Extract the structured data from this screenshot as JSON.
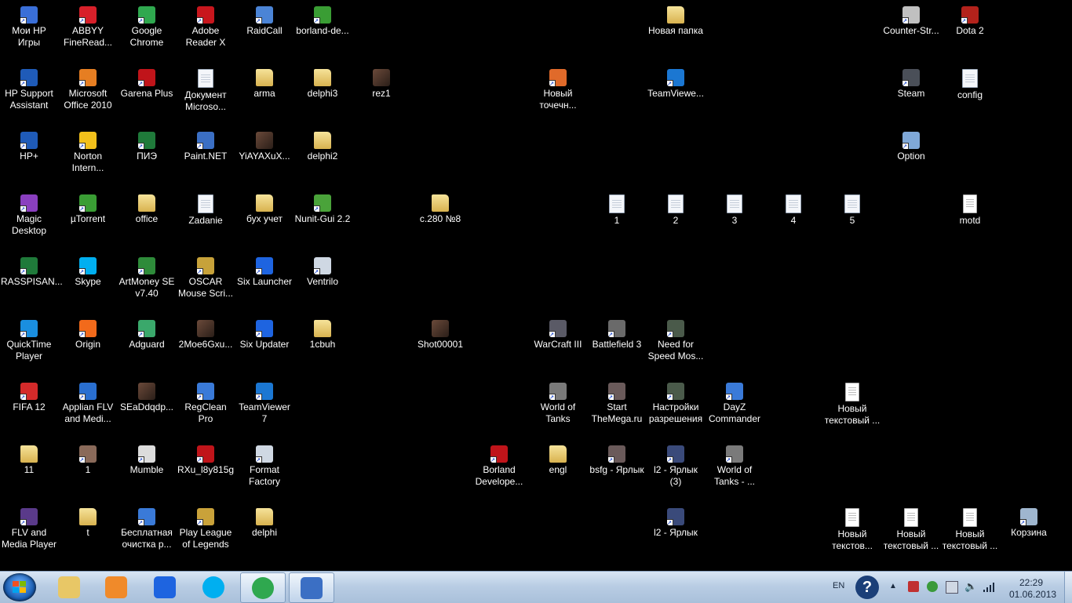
{
  "desktop_icons": [
    {
      "name": "moi-hp-igry",
      "label": "Мои HP Игры",
      "kind": "app",
      "color": "#3a6fd8"
    },
    {
      "name": "abbyy-finereader",
      "label": "ABBYY FineRead...",
      "kind": "app",
      "color": "#d8202a"
    },
    {
      "name": "google-chrome",
      "label": "Google Chrome",
      "kind": "app",
      "color": "#2fa84f"
    },
    {
      "name": "adobe-reader-x",
      "label": "Adobe Reader X",
      "kind": "app",
      "color": "#c8161d"
    },
    {
      "name": "raidcall",
      "label": "RaidCall",
      "kind": "app",
      "color": "#4b84d6"
    },
    {
      "name": "borland-de",
      "label": "borland-de...",
      "kind": "app",
      "color": "#3a9d34"
    },
    {
      "name": "novaya-papka",
      "label": "Новая папка",
      "kind": "folder",
      "color": "#e8c766"
    },
    {
      "name": "counter-strike",
      "label": "Counter-Str...",
      "kind": "app",
      "color": "#c0c0c0"
    },
    {
      "name": "dota-2",
      "label": "Dota 2",
      "kind": "app",
      "color": "#b3221b"
    },
    {
      "name": "hp-support-assistant",
      "label": "HP Support Assistant",
      "kind": "app",
      "color": "#1f5bb8"
    },
    {
      "name": "microsoft-office-2010",
      "label": "Microsoft Office 2010",
      "kind": "app",
      "color": "#e67e22"
    },
    {
      "name": "garena-plus",
      "label": "Garena Plus",
      "kind": "app",
      "color": "#c0141a"
    },
    {
      "name": "dokument-microsoft",
      "label": "Документ Microso...",
      "kind": "doc",
      "color": "#2b5797"
    },
    {
      "name": "arma",
      "label": "arma",
      "kind": "folder",
      "color": "#e8c766"
    },
    {
      "name": "delphi3",
      "label": "delphi3",
      "kind": "folder",
      "color": "#e8c766"
    },
    {
      "name": "rez1",
      "label": "rez1",
      "kind": "thumb",
      "color": "#5a4a3a"
    },
    {
      "name": "novyy-tochechnyy",
      "label": "Новый точечн...",
      "kind": "app",
      "color": "#e06a2a"
    },
    {
      "name": "teamviewer-top",
      "label": "TeamViewe...",
      "kind": "app",
      "color": "#1b77d2"
    },
    {
      "name": "steam",
      "label": "Steam",
      "kind": "app",
      "color": "#4a4f58"
    },
    {
      "name": "config",
      "label": "config",
      "kind": "doc",
      "color": "#7fa8d8"
    },
    {
      "name": "hp-plus",
      "label": "HP+",
      "kind": "app",
      "color": "#1f5bb8"
    },
    {
      "name": "norton-internet",
      "label": "Norton Intern...",
      "kind": "app",
      "color": "#f2c01b"
    },
    {
      "name": "piz",
      "label": "ПИЭ",
      "kind": "app",
      "color": "#1f7a3a"
    },
    {
      "name": "paint-net",
      "label": "Paint.NET",
      "kind": "app",
      "color": "#3b6fc4"
    },
    {
      "name": "yiayaxux",
      "label": "YiAYAXuX...",
      "kind": "thumb",
      "color": "#6b4a3a"
    },
    {
      "name": "delphi2",
      "label": "delphi2",
      "kind": "folder",
      "color": "#e8c766"
    },
    {
      "name": "option",
      "label": "Option",
      "kind": "app",
      "color": "#7fa8d8"
    },
    {
      "name": "magic-desktop",
      "label": "Magic Desktop",
      "kind": "app",
      "color": "#8a3fbf"
    },
    {
      "name": "utorrent",
      "label": "µTorrent",
      "kind": "app",
      "color": "#3a9d34"
    },
    {
      "name": "office",
      "label": "office",
      "kind": "folder",
      "color": "#e8c766"
    },
    {
      "name": "zadanie",
      "label": "Zadanie",
      "kind": "doc",
      "color": "#2b5797"
    },
    {
      "name": "buh-uchet",
      "label": "бух учет",
      "kind": "folder",
      "color": "#e8c766"
    },
    {
      "name": "nunit-gui",
      "label": "Nunit-Gui 2.2",
      "kind": "app",
      "color": "#4aa33a"
    },
    {
      "name": "c280-n8",
      "label": "с.280 №8",
      "kind": "folder",
      "color": "#e8c766"
    },
    {
      "name": "doc-1",
      "label": "1",
      "kind": "doc",
      "color": "#2b5797"
    },
    {
      "name": "doc-2",
      "label": "2",
      "kind": "doc",
      "color": "#2b5797"
    },
    {
      "name": "doc-3",
      "label": "3",
      "kind": "doc",
      "color": "#2b5797"
    },
    {
      "name": "doc-4",
      "label": "4",
      "kind": "doc",
      "color": "#2b5797"
    },
    {
      "name": "doc-5",
      "label": "5",
      "kind": "doc",
      "color": "#2b5797"
    },
    {
      "name": "motd",
      "label": "motd",
      "kind": "text",
      "color": "#ffffff"
    },
    {
      "name": "rasspisan",
      "label": "RASSPISAN...",
      "kind": "app",
      "color": "#1f7a3a"
    },
    {
      "name": "skype",
      "label": "Skype",
      "kind": "app",
      "color": "#00aff0"
    },
    {
      "name": "artmoney-se",
      "label": "ArtMoney SE v7.40",
      "kind": "app",
      "color": "#2e8b3a"
    },
    {
      "name": "oscar-mouse",
      "label": "OSCAR Mouse Scri...",
      "kind": "app",
      "color": "#c7a23a"
    },
    {
      "name": "six-launcher",
      "label": "Six Launcher",
      "kind": "app",
      "color": "#1e64e0"
    },
    {
      "name": "ventrilo",
      "label": "Ventrilo",
      "kind": "app",
      "color": "#cfd8e3"
    },
    {
      "name": "quicktime-player",
      "label": "QuickTime Player",
      "kind": "app",
      "color": "#1a8fe0"
    },
    {
      "name": "origin",
      "label": "Origin",
      "kind": "app",
      "color": "#f26a1b"
    },
    {
      "name": "adguard",
      "label": "Adguard",
      "kind": "app",
      "color": "#3aa86b"
    },
    {
      "name": "2moe6gxu",
      "label": "2Moe6Gxu...",
      "kind": "thumb",
      "color": "#5a3a3a"
    },
    {
      "name": "six-updater",
      "label": "Six Updater",
      "kind": "app",
      "color": "#1e64e0"
    },
    {
      "name": "1cbuh",
      "label": "1cbuh",
      "kind": "folder",
      "color": "#e8c766"
    },
    {
      "name": "shot00001",
      "label": "Shot00001",
      "kind": "thumb",
      "color": "#3a2e28"
    },
    {
      "name": "warcraft-iii",
      "label": "WarCraft III",
      "kind": "app",
      "color": "#5a5a66"
    },
    {
      "name": "battlefield-3",
      "label": "Battlefield 3",
      "kind": "app",
      "color": "#6a6a6a"
    },
    {
      "name": "need-for-speed",
      "label": "Need for Speed Mos...",
      "kind": "app",
      "color": "#4a5a4a"
    },
    {
      "name": "fifa-12",
      "label": "FIFA 12",
      "kind": "app",
      "color": "#d42a2a"
    },
    {
      "name": "applian-flv",
      "label": "Applian FLV and Medi...",
      "kind": "app",
      "color": "#2a6fd0"
    },
    {
      "name": "seaddqdp",
      "label": "SEaDdqdp...",
      "kind": "thumb",
      "color": "#6b4a3a"
    },
    {
      "name": "regclean-pro",
      "label": "RegClean Pro",
      "kind": "app",
      "color": "#3a7ad8"
    },
    {
      "name": "teamviewer-7",
      "label": "TeamViewer 7",
      "kind": "app",
      "color": "#1b77d2"
    },
    {
      "name": "world-of-tanks",
      "label": "World of Tanks",
      "kind": "app",
      "color": "#7a7a7a"
    },
    {
      "name": "start-themega",
      "label": "Start TheMega.ru",
      "kind": "app",
      "color": "#6a5a5a"
    },
    {
      "name": "nastroyki-razresheniya",
      "label": "Настройки разрешения",
      "kind": "app",
      "color": "#4a5a4a"
    },
    {
      "name": "dayz-commander",
      "label": "DayZ Commander",
      "kind": "app",
      "color": "#3a7ad8"
    },
    {
      "name": "novyy-tekstovyy-1",
      "label": "Новый текстовый ...",
      "kind": "text",
      "color": "#ffffff"
    },
    {
      "name": "folder-11",
      "label": "11",
      "kind": "folder",
      "color": "#d8c28a"
    },
    {
      "name": "item-1",
      "label": "1",
      "kind": "app",
      "color": "#8a6a5a"
    },
    {
      "name": "mumble",
      "label": "Mumble",
      "kind": "app",
      "color": "#dcdcdc"
    },
    {
      "name": "rxu-l8y815g",
      "label": "RXu_l8y815g",
      "kind": "app",
      "color": "#c0141a"
    },
    {
      "name": "format-factory",
      "label": "Format Factory",
      "kind": "app",
      "color": "#cfd8e3"
    },
    {
      "name": "borland-developer",
      "label": "Borland Develope...",
      "kind": "app",
      "color": "#c0141a"
    },
    {
      "name": "engl",
      "label": "engl",
      "kind": "folder",
      "color": "#e8c766"
    },
    {
      "name": "bsfg-yarlyk",
      "label": "bsfg - Ярлык",
      "kind": "app",
      "color": "#6a5a5a"
    },
    {
      "name": "l2-yarlyk-3",
      "label": "l2 - Ярлык (3)",
      "kind": "app",
      "color": "#3a4a7a"
    },
    {
      "name": "world-of-tanks-2",
      "label": "World of Tanks - ...",
      "kind": "app",
      "color": "#7a7a7a"
    },
    {
      "name": "flv-media-player",
      "label": "FLV and Media Player",
      "kind": "app",
      "color": "#5a3a8a"
    },
    {
      "name": "t",
      "label": "t",
      "kind": "folder",
      "color": "#e8c766"
    },
    {
      "name": "besplatnaya-ochistka",
      "label": "Бесплатная очистка р...",
      "kind": "app",
      "color": "#3a7ad8"
    },
    {
      "name": "play-league",
      "label": "Play League of Legends",
      "kind": "app",
      "color": "#c9a23a"
    },
    {
      "name": "delphi",
      "label": "delphi",
      "kind": "folder",
      "color": "#e8c766"
    },
    {
      "name": "l2-yarlyk",
      "label": "l2 - Ярлык",
      "kind": "app",
      "color": "#3a4a7a"
    },
    {
      "name": "novyy-tekstov-2",
      "label": "Новый текстов...",
      "kind": "text",
      "color": "#ffffff"
    },
    {
      "name": "novyy-tekstovyy-3",
      "label": "Новый текстовый ...",
      "kind": "text",
      "color": "#ffffff"
    },
    {
      "name": "novyy-tekstovyy-4",
      "label": "Новый текстовый ...",
      "kind": "text",
      "color": "#ffffff"
    },
    {
      "name": "korzina",
      "label": "Корзина",
      "kind": "app",
      "color": "#9fb6cf"
    }
  ],
  "taskbar": {
    "pinned": [
      {
        "name": "explorer",
        "icon": "folder-icon",
        "color": "#e8c766",
        "active": false
      },
      {
        "name": "media-player",
        "icon": "media-player-icon",
        "color": "#f08a2a",
        "active": false
      },
      {
        "name": "six-launcher",
        "icon": "six-launcher-icon",
        "color": "#1e64e0",
        "active": false
      },
      {
        "name": "skype",
        "icon": "skype-icon",
        "color": "#00aff0",
        "active": false
      },
      {
        "name": "chrome",
        "icon": "chrome-icon",
        "color": "#2fa84f",
        "active": true
      },
      {
        "name": "paint-net",
        "icon": "paint-icon",
        "color": "#3b6fc4",
        "active": true
      }
    ],
    "tray": {
      "language": "EN",
      "time": "22:29",
      "date": "01.06.2013"
    }
  }
}
